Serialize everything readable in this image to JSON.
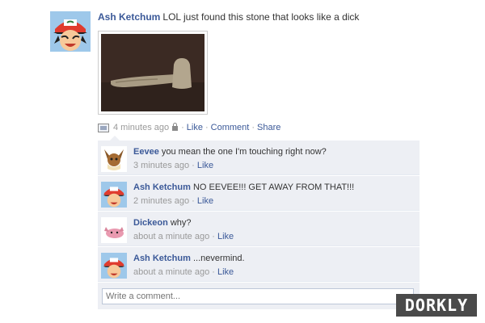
{
  "post": {
    "author": "Ash Ketchum",
    "message": "LOL just found this stone that looks like a dick",
    "time": "4 minutes ago",
    "separator": "·",
    "actions": [
      "Like",
      "Comment",
      "Share"
    ],
    "avatar_icon": "ash-ketchum-avatar",
    "photo_icon": "stone-photo"
  },
  "comments": [
    {
      "author": "Eevee",
      "text": "you mean the one I'm touching right now?",
      "time": "3 minutes ago",
      "like": "Like",
      "avatar_icon": "eevee-avatar"
    },
    {
      "author": "Ash Ketchum",
      "text": "NO EEVEE!!! GET AWAY FROM THAT!!!",
      "time": "2 minutes ago",
      "like": "Like",
      "avatar_icon": "ash-ketchum-avatar"
    },
    {
      "author": "Dickeon",
      "text": "why?",
      "time": "about a minute ago",
      "like": "Like",
      "avatar_icon": "dickeon-avatar"
    },
    {
      "author": "Ash Ketchum",
      "text": "...nevermind.",
      "time": "about a minute ago",
      "like": "Like",
      "avatar_icon": "ash-ketchum-avatar"
    }
  ],
  "comment_box": {
    "placeholder": "Write a comment..."
  },
  "watermark": "DORKLY",
  "colors": {
    "link": "#3b5998",
    "comment_bg": "#edeff4",
    "meta": "#999999"
  }
}
